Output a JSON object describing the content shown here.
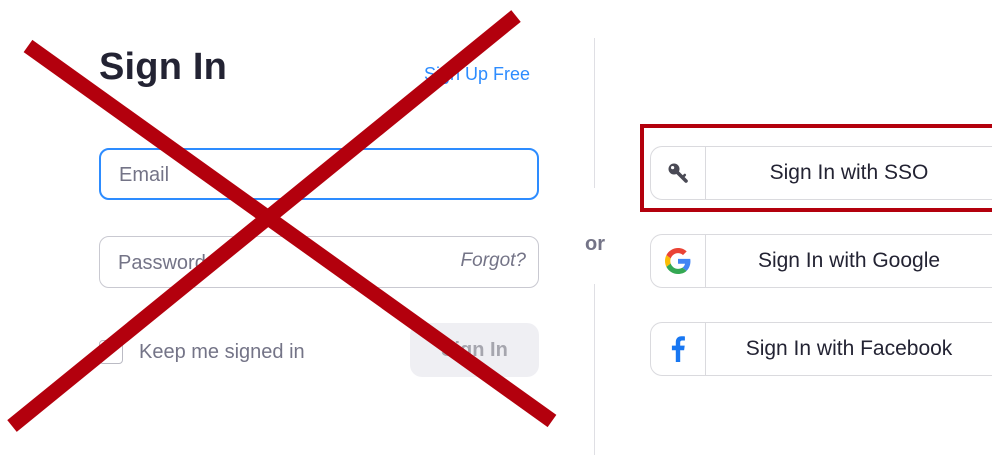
{
  "login": {
    "title": "Sign In",
    "signup_link": "Sign Up Free",
    "email_placeholder": "Email",
    "password_placeholder": "Password",
    "forgot_link": "Forgot?",
    "keep_signed_in_label": "Keep me signed in",
    "signin_button": "Sign In"
  },
  "separator": {
    "or_label": "or"
  },
  "alternatives": {
    "sso_label": "Sign In with SSO",
    "google_label": "Sign In with Google",
    "facebook_label": "Sign In with Facebook"
  },
  "icons": {
    "sso": "key-icon",
    "google": "google-icon",
    "facebook": "facebook-icon"
  },
  "colors": {
    "accent_blue": "#2D8CFF",
    "annotation_red": "#B3000D",
    "title_text": "#232333",
    "muted_text": "#747487",
    "facebook_blue": "#1877F2"
  },
  "annotations": {
    "cross_out_left_panel": true,
    "highlight": "Sign In with SSO"
  }
}
